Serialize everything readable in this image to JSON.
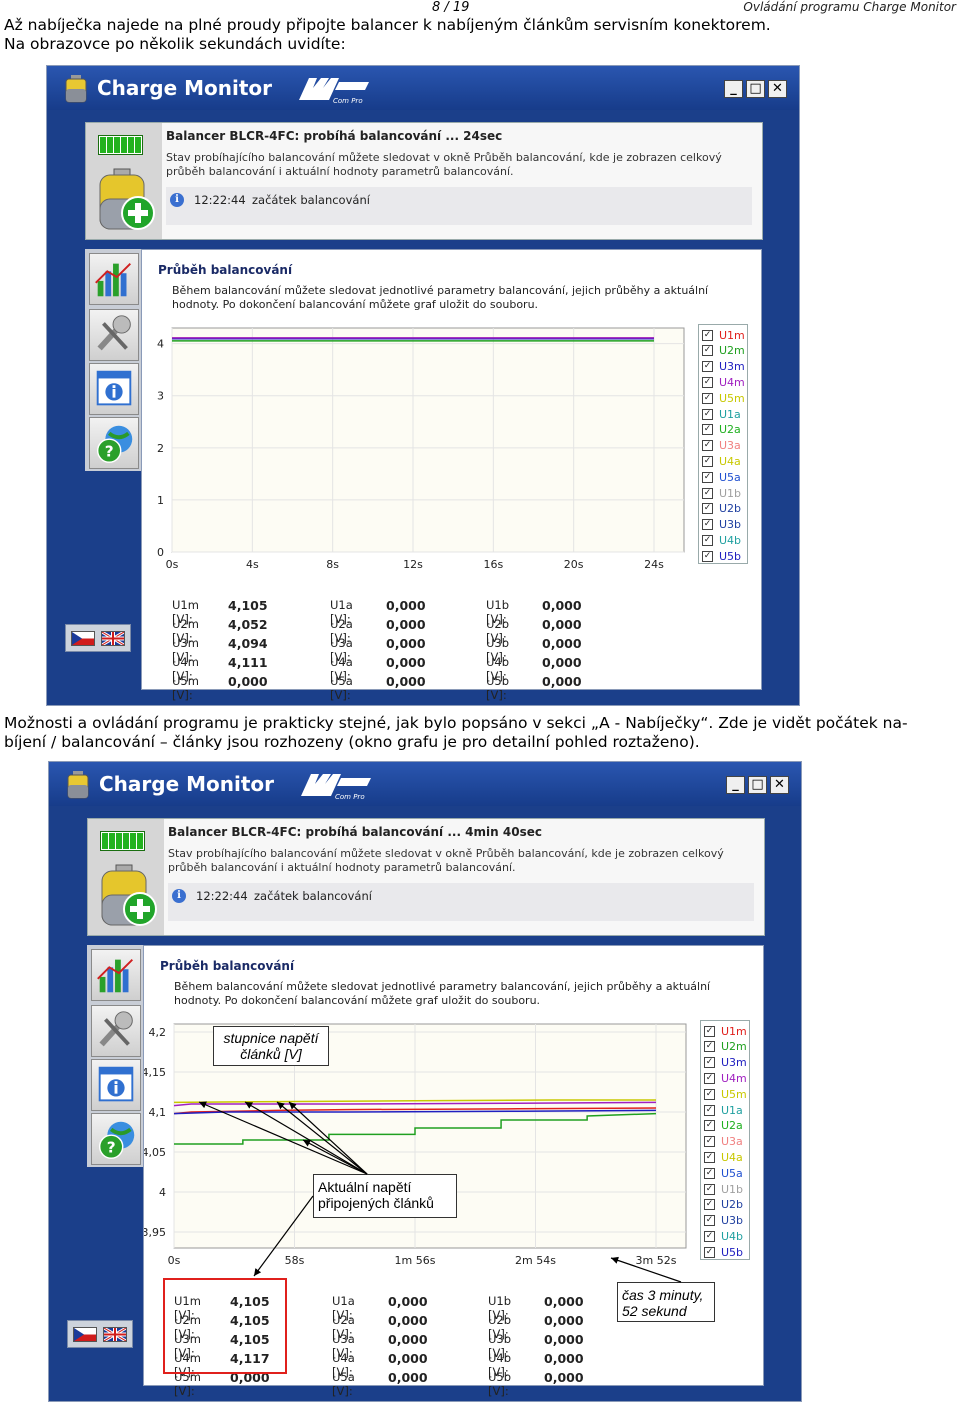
{
  "header": {
    "page": "8 / 19",
    "running_title": "Ovládání programu Charge Monitor"
  },
  "text": {
    "para1_line1": "Až nabíječka najede na plné proudy připojte balancer k nabíjeným článkům servisním konektorem.",
    "para1_line2": "Na obrazovce po několik sekundách uvidíte:",
    "para2_line1": "Možnosti a ovládání programu je prakticky stejné, jak bylo popsáno v sekci „A - Nabíječky“. Zde je vidět počátek na-",
    "para2_line2": "bíjení / balancování – články jsou rozhozeny (okno grafu je pro detailní pohled roztaženo)."
  },
  "app": {
    "title": "Charge Monitor",
    "logo_text": "Com Pro",
    "window_buttons": [
      "_",
      "□",
      "✕"
    ],
    "icons": {
      "app": "battery-icon",
      "status": "battery-level-icon",
      "add": "battery-add-icon",
      "chart": "chart-icon",
      "tools": "tools-icon",
      "about": "info-window-icon",
      "help": "help-globe-icon",
      "lang_cz": "czech-flag-icon",
      "lang_en": "uk-flag-icon"
    }
  },
  "screens": [
    {
      "info": {
        "title": "Balancer BLCR-4FC: probíhá balancování ... 24sec",
        "desc": "Stav probíhajícího balancování můžete sledovat v okně Průběh balancování, kde je zobrazen celkový průběh balancování i aktuální hodnoty parametrů balancování.",
        "time": "12:22:44",
        "message": "začátek balancování"
      },
      "panel": {
        "title": "Průběh balancování",
        "desc": "Během balancování můžete sledovat jednotlivé parametry balancování, jejich průběhy a aktuální hodnoty. Po dokončení balancování můžete graf uložit do souboru."
      },
      "values": [
        [
          {
            "l": "U1m [V]:",
            "v": "4,105"
          },
          {
            "l": "U2m [V]:",
            "v": "4,052"
          },
          {
            "l": "U3m [V]:",
            "v": "4,094"
          },
          {
            "l": "U4m [V]:",
            "v": "4,111"
          },
          {
            "l": "U5m [V]:",
            "v": "0,000"
          }
        ],
        [
          {
            "l": "U1a [V]:",
            "v": "0,000"
          },
          {
            "l": "U2a [V]:",
            "v": "0,000"
          },
          {
            "l": "U3a [V]:",
            "v": "0,000"
          },
          {
            "l": "U4a [V]:",
            "v": "0,000"
          },
          {
            "l": "U5a [V]:",
            "v": "0,000"
          }
        ],
        [
          {
            "l": "U1b [V]:",
            "v": "0,000"
          },
          {
            "l": "U2b [V]:",
            "v": "0,000"
          },
          {
            "l": "U3b [V]:",
            "v": "0,000"
          },
          {
            "l": "U4b [V]:",
            "v": "0,000"
          },
          {
            "l": "U5b [V]:",
            "v": "0,000"
          }
        ]
      ]
    },
    {
      "info": {
        "title": "Balancer BLCR-4FC: probíhá balancování ... 4min 40sec",
        "desc": "Stav probíhajícího balancování můžete sledovat v okně Průběh balancování, kde je zobrazen celkový průběh balancování i aktuální hodnoty parametrů balancování.",
        "time": "12:22:44",
        "message": "začátek balancování"
      },
      "panel": {
        "title": "Průběh balancování",
        "desc": "Během balancování můžete sledovat jednotlivé parametry balancování, jejich průběhy a aktuální hodnoty. Po dokončení balancování můžete graf uložit do souboru."
      },
      "values": [
        [
          {
            "l": "U1m [V]:",
            "v": "4,105"
          },
          {
            "l": "U2m [V]:",
            "v": "4,105"
          },
          {
            "l": "U3m [V]:",
            "v": "4,105"
          },
          {
            "l": "U4m [V]:",
            "v": "4,117"
          },
          {
            "l": "U5m [V]:",
            "v": "0,000"
          }
        ],
        [
          {
            "l": "U1a [V]:",
            "v": "0,000"
          },
          {
            "l": "U2a [V]:",
            "v": "0,000"
          },
          {
            "l": "U3a [V]:",
            "v": "0,000"
          },
          {
            "l": "U4a [V]:",
            "v": "0,000"
          },
          {
            "l": "U5a [V]:",
            "v": "0,000"
          }
        ],
        [
          {
            "l": "U1b [V]:",
            "v": "0,000"
          },
          {
            "l": "U2b [V]:",
            "v": "0,000"
          },
          {
            "l": "U3b [V]:",
            "v": "0,000"
          },
          {
            "l": "U4b [V]:",
            "v": "0,000"
          },
          {
            "l": "U5b [V]:",
            "v": "0,000"
          }
        ]
      ],
      "callouts": {
        "steps": "stupnice napětí článků [V]",
        "actual": "Aktuální napětí připojených článků",
        "time": "čas 3 minuty, 52 sekund"
      }
    }
  ],
  "legend": [
    {
      "name": "U1m",
      "color": "#e0201c"
    },
    {
      "name": "U2m",
      "color": "#20a020"
    },
    {
      "name": "U3m",
      "color": "#2020c0"
    },
    {
      "name": "U4m",
      "color": "#a020c0"
    },
    {
      "name": "U5m",
      "color": "#c8c800"
    },
    {
      "name": "U1a",
      "color": "#20a0a0"
    },
    {
      "name": "U2a",
      "color": "#20b020"
    },
    {
      "name": "U3a",
      "color": "#f08080"
    },
    {
      "name": "U4a",
      "color": "#c8c800"
    },
    {
      "name": "U5a",
      "color": "#2050d0"
    },
    {
      "name": "U1b",
      "color": "#a0a0a0"
    },
    {
      "name": "U2b",
      "color": "#2040a0"
    },
    {
      "name": "U3b",
      "color": "#2040a0"
    },
    {
      "name": "U4b",
      "color": "#20a0a0"
    },
    {
      "name": "U5b",
      "color": "#2020c0"
    }
  ],
  "chart_data": [
    {
      "type": "line",
      "x_ticks": [
        "0s",
        "4s",
        "8s",
        "12s",
        "16s",
        "20s",
        "24s"
      ],
      "y_ticks": [
        "0",
        "1",
        "2",
        "3",
        "4"
      ],
      "xlim": [
        0,
        26
      ],
      "ylim": [
        0,
        4.3
      ],
      "series": [
        {
          "name": "U1m",
          "color": "#e0201c",
          "x": [
            0,
            26
          ],
          "y": [
            4.105,
            4.105
          ]
        },
        {
          "name": "U2m",
          "color": "#20a020",
          "x": [
            0,
            26
          ],
          "y": [
            4.052,
            4.052
          ]
        },
        {
          "name": "U3m",
          "color": "#2020c0",
          "x": [
            0,
            26
          ],
          "y": [
            4.094,
            4.094
          ]
        },
        {
          "name": "U4m",
          "color": "#a020c0",
          "x": [
            0,
            26
          ],
          "y": [
            4.111,
            4.111
          ]
        }
      ]
    },
    {
      "type": "line",
      "x_ticks": [
        "0s",
        "58s",
        "1m 56s",
        "2m 54s",
        "3m 52s"
      ],
      "y_ticks": [
        "4,2",
        "4,15",
        "4,1",
        "4,05",
        "4",
        "3,95"
      ],
      "xlim": [
        0,
        280
      ],
      "ylim": [
        3.93,
        4.21
      ],
      "series": [
        {
          "name": "U1m",
          "color": "#e0201c",
          "x": [
            0,
            10,
            60,
            100,
            200,
            280
          ],
          "y": [
            4.098,
            4.1,
            4.102,
            4.103,
            4.104,
            4.105
          ]
        },
        {
          "name": "U2m",
          "color": "#20a020",
          "x": [
            0,
            40,
            40,
            90,
            90,
            140,
            140,
            190,
            190,
            240,
            240,
            280
          ],
          "y": [
            4.06,
            4.06,
            4.065,
            4.065,
            4.072,
            4.072,
            4.08,
            4.08,
            4.09,
            4.09,
            4.095,
            4.098
          ]
        },
        {
          "name": "U3m",
          "color": "#2020c0",
          "x": [
            0,
            30,
            100,
            200,
            280
          ],
          "y": [
            4.098,
            4.1,
            4.1,
            4.101,
            4.102
          ]
        },
        {
          "name": "U4m",
          "color": "#a020c0",
          "x": [
            0,
            10,
            100,
            200,
            280
          ],
          "y": [
            4.108,
            4.11,
            4.11,
            4.111,
            4.112
          ]
        },
        {
          "name": "U5m",
          "color": "#c8c800",
          "x": [
            0,
            60,
            140,
            220,
            280
          ],
          "y": [
            4.112,
            4.113,
            4.114,
            4.115,
            4.115
          ]
        }
      ]
    }
  ]
}
